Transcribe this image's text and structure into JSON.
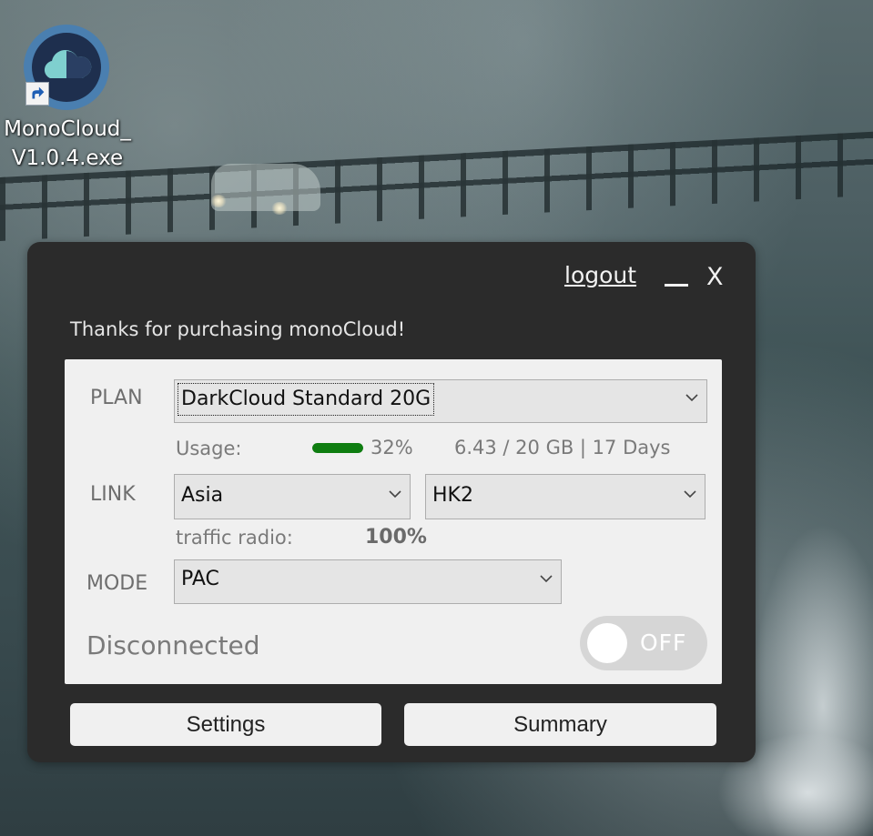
{
  "desktop": {
    "icon_name": "monocloud-app-icon",
    "label": "MonoCloud_\nV1.0.4.exe"
  },
  "window": {
    "logout_label": "logout",
    "minimize_symbol": "_",
    "close_symbol": "X",
    "thanks_text": "Thanks for purchasing monoCloud!"
  },
  "plan": {
    "label": "PLAN",
    "selected": "DarkCloud Standard 20G",
    "usage_label": "Usage:",
    "usage_percent": "32%",
    "usage_fraction": 0.32,
    "usage_detail": "6.43 / 20 GB | 17 Days"
  },
  "link": {
    "label": "LINK",
    "region_selected": "Asia",
    "server_selected": "HK2",
    "traffic_label": "traffic radio:",
    "traffic_value": "100%"
  },
  "mode": {
    "label": "MODE",
    "selected": "PAC"
  },
  "connection": {
    "status": "Disconnected",
    "toggle_label": "OFF"
  },
  "buttons": {
    "settings": "Settings",
    "summary": "Summary"
  },
  "colors": {
    "window_bg": "#2b2b2b",
    "panel_bg": "#f0f0f0",
    "progress_fill": "#0e7d10",
    "toggle_off": "#d6d6d6"
  }
}
